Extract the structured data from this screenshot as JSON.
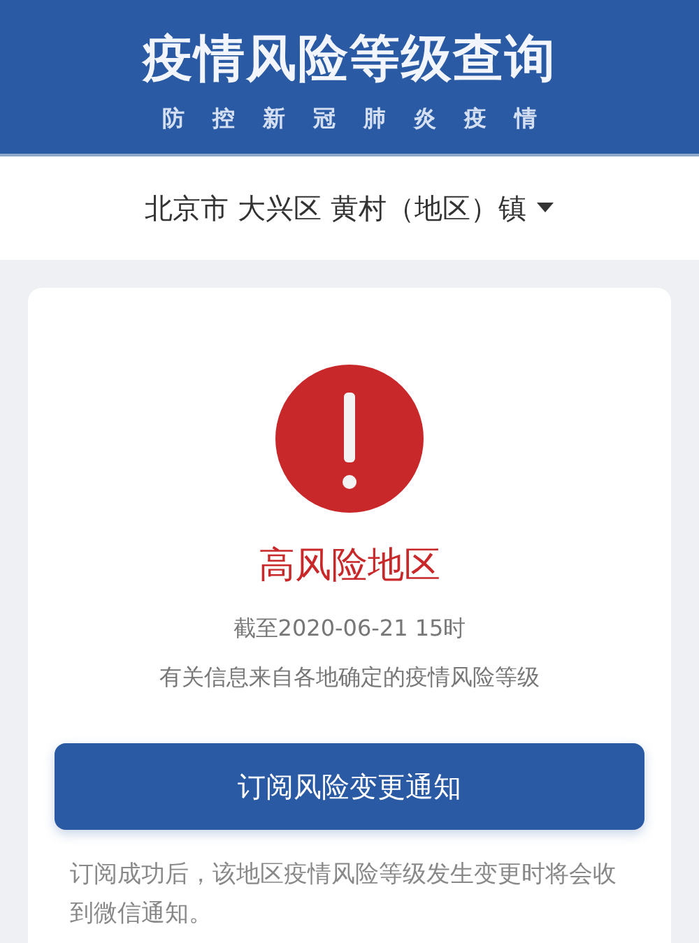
{
  "header": {
    "title": "疫情风险等级查询",
    "subtitle": [
      "防",
      "控",
      "新",
      "冠",
      "肺",
      "炎",
      "疫",
      "情"
    ]
  },
  "region": {
    "label": "北京市 大兴区 黄村（地区）镇"
  },
  "result": {
    "kind": "high",
    "label": "高风险地区",
    "as_of": "截至2020-06-21 15时",
    "source": "有关信息来自各地确定的疫情风险等级"
  },
  "subscribe_button": "订阅风险变更通知",
  "note": "订阅成功后，该地区疫情风险等级发生变更时将会收到微信通知。"
}
